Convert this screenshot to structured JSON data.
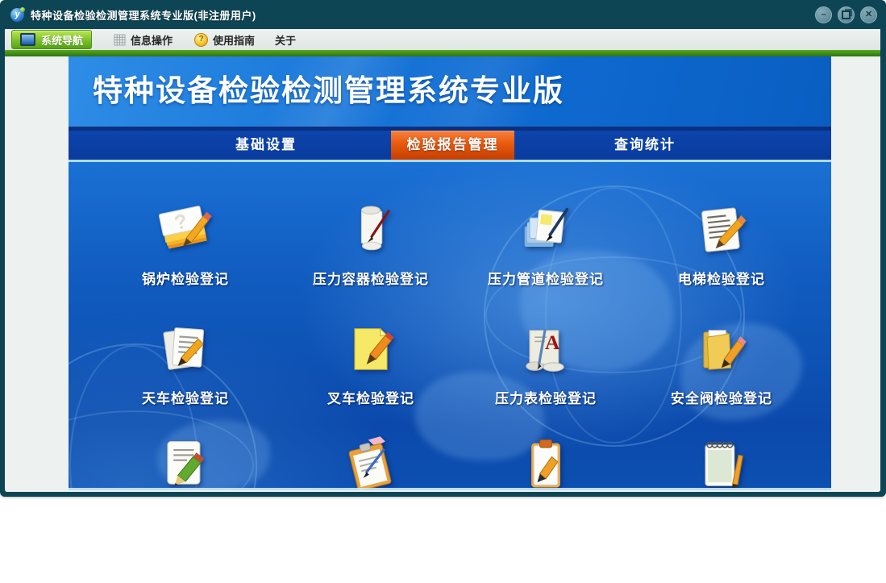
{
  "window": {
    "title": "特种设备检验检测管理系统专业版(非注册用户)",
    "controls": {
      "minimize_glyph": "–",
      "close_glyph": "✕"
    }
  },
  "menu": {
    "items": [
      {
        "label": "系统导航",
        "icon": "monitor-icon",
        "active": true
      },
      {
        "label": "信息操作",
        "icon": "grid-icon",
        "active": false
      },
      {
        "label": "使用指南",
        "icon": "help-coin-icon",
        "active": false
      },
      {
        "label": "关于",
        "icon": null,
        "active": false
      }
    ],
    "help_coin_glyph": "?"
  },
  "banner": {
    "title": "特种设备检验检测管理系统专业版"
  },
  "tabs": {
    "active_label": "检验报告管理",
    "items": [
      {
        "label": "基础设置"
      },
      {
        "label": "检验报告管理"
      },
      {
        "label": "查询统计"
      }
    ]
  },
  "launcher": {
    "rows": [
      {
        "items": [
          {
            "label": "锅炉检验登记",
            "icon": "notepad-question-pencil-icon"
          },
          {
            "label": "压力容器检验登记",
            "icon": "scroll-pen-icon"
          },
          {
            "label": "压力管道检验登记",
            "icon": "document-stack-pen-icon"
          },
          {
            "label": "电梯检验登记",
            "icon": "notepad-lines-pencil-icon"
          }
        ]
      },
      {
        "items": [
          {
            "label": "天车检验登记",
            "icon": "papers-pencil-icon"
          },
          {
            "label": "叉车检验登记",
            "icon": "sticky-note-pencil-icon"
          },
          {
            "label": "压力表检验登记",
            "icon": "scroll-letter-a-pen-icon"
          },
          {
            "label": "安全阀检验登记",
            "icon": "folder-pencil-icon"
          }
        ]
      },
      {
        "items": [
          {
            "label": "",
            "icon": "note-green-pencil-icon"
          },
          {
            "label": "",
            "icon": "clipboard-pen-icon"
          },
          {
            "label": "",
            "icon": "clipboard-pencil-icon"
          },
          {
            "label": "",
            "icon": "spiral-notepad-pencil-icon"
          }
        ]
      }
    ]
  },
  "colors": {
    "titlebar_teal": "#0e4555",
    "accent_green": "#55a213",
    "banner_blue": "#0f6cd2",
    "tab_navy": "#0a3a9c",
    "active_tab_orange": "#e85a0e",
    "map_blue": "#0b4aac"
  }
}
